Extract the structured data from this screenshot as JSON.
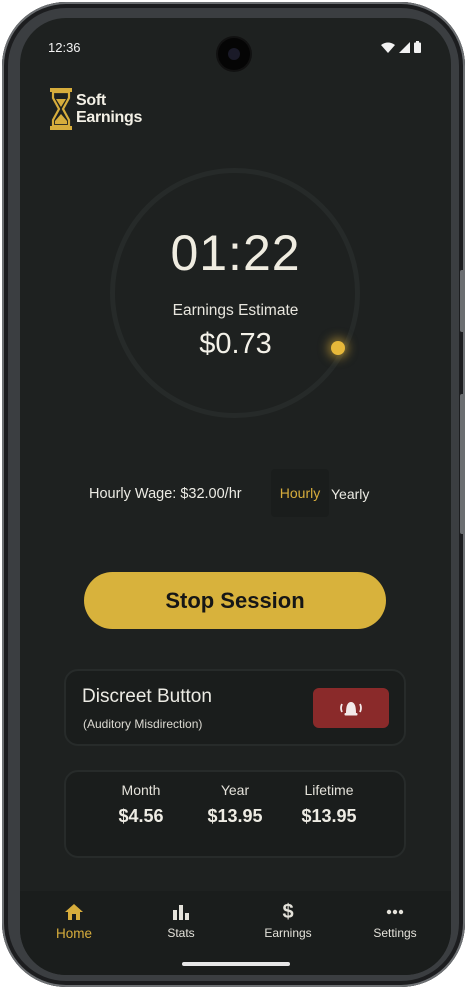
{
  "status_bar": {
    "time": "12:36",
    "icons": [
      "wifi-icon",
      "signal-icon",
      "battery-icon"
    ]
  },
  "app": {
    "logo_line1": "Soft",
    "logo_line2": "Earnings",
    "logo_icon": "hourglass-icon"
  },
  "timer": {
    "elapsed": "01:22",
    "earnings_label": "Earnings Estimate",
    "earnings_value": "$0.73"
  },
  "wage": {
    "label": "Hourly Wage: $32.00/hr",
    "toggle_hourly": "Hourly",
    "toggle_yearly": "Yearly",
    "selected": "Hourly"
  },
  "session": {
    "stop_label": "Stop Session"
  },
  "discreet": {
    "title": "Discreet Button",
    "subtitle": "(Auditory Misdirection)",
    "button_icon": "alarm-bell-icon"
  },
  "stats": [
    {
      "label": "Month",
      "value": "$4.56"
    },
    {
      "label": "Year",
      "value": "$13.95"
    },
    {
      "label": "Lifetime",
      "value": "$13.95"
    }
  ],
  "nav": [
    {
      "label": "Home",
      "icon": "home-icon",
      "active": true
    },
    {
      "label": "Stats",
      "icon": "bar-chart-icon",
      "active": false
    },
    {
      "label": "Earnings",
      "icon": "dollar-icon",
      "active": false
    },
    {
      "label": "Settings",
      "icon": "more-icon",
      "active": false
    }
  ],
  "colors": {
    "accent": "#D8B23C",
    "background": "#1E2120",
    "card": "#1A1D1C",
    "alarm": "#8A2A2A"
  }
}
